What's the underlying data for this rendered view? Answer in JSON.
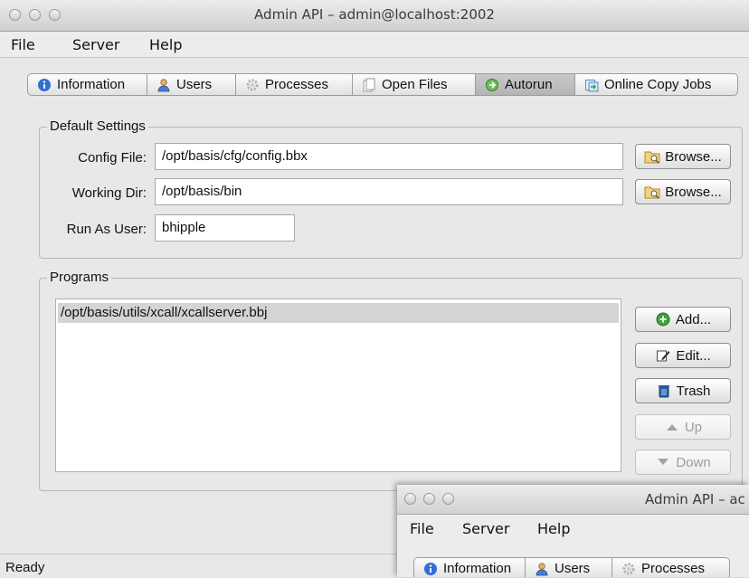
{
  "window": {
    "title": "Admin API – admin@localhost:2002"
  },
  "menu": [
    "File",
    "Server",
    "Help"
  ],
  "tabs": [
    {
      "label": "Information",
      "icon": "info-icon"
    },
    {
      "label": "Users",
      "icon": "users-icon"
    },
    {
      "label": "Processes",
      "icon": "gear-icon"
    },
    {
      "label": "Open Files",
      "icon": "files-icon"
    },
    {
      "label": "Autorun",
      "icon": "autorun-icon",
      "active": true
    },
    {
      "label": "Online Copy Jobs",
      "icon": "copy-icon"
    }
  ],
  "default_settings": {
    "title": "Default Settings",
    "config_file_label": "Config File:",
    "config_file_value": "/opt/basis/cfg/config.bbx",
    "working_dir_label": "Working Dir:",
    "working_dir_value": "/opt/basis/bin",
    "run_as_label": "Run As User:",
    "run_as_value": "bhipple",
    "browse_label": "Browse..."
  },
  "programs": {
    "title": "Programs",
    "items": [
      "/opt/basis/utils/xcall/xcallserver.bbj"
    ],
    "buttons": {
      "add": "Add...",
      "edit": "Edit...",
      "trash": "Trash",
      "up": "Up",
      "down": "Down"
    }
  },
  "status": "Ready",
  "second_window": {
    "title": "Admin API – ac",
    "menu": [
      "File",
      "Server",
      "Help"
    ],
    "tabs": [
      "Information",
      "Users",
      "Processes"
    ]
  },
  "colors": {
    "accent_active_tab": "#bdbdbd",
    "selection": "#d4d4d4",
    "info_icon": "#2f6fd6",
    "add_icon": "#3aa53a"
  }
}
